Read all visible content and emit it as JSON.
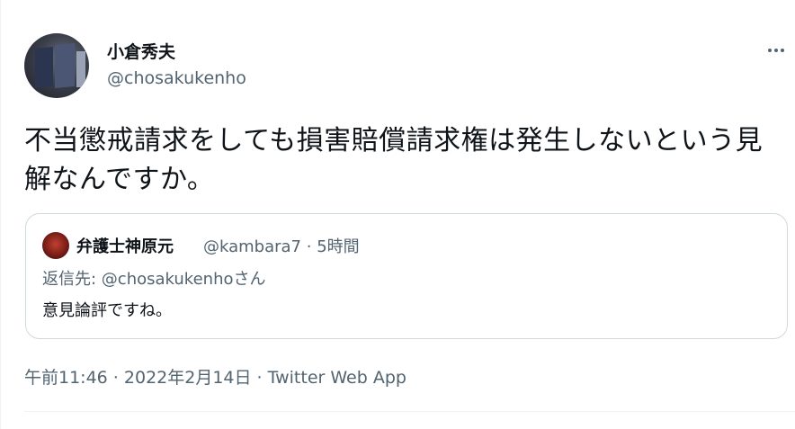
{
  "author": {
    "display_name": "小倉秀夫",
    "handle": "@chosakukenho"
  },
  "tweet": {
    "text": "不当懲戒請求をしても損害賠償請求権は発生しないという見解なんですか。"
  },
  "quoted_tweet": {
    "display_name": "弁護士神原元",
    "handle": "@kambara7",
    "separator": "·",
    "time": "5時間",
    "reply_prefix": "返信先: ",
    "reply_to": "@chosakukenho",
    "reply_suffix": "さん",
    "text": "意見論評ですね。"
  },
  "timestamp": {
    "time": "午前11:46",
    "date": "2022年2月14日",
    "separator": " · ",
    "client": "Twitter Web App"
  },
  "icons": {
    "more": "more-horizontal-icon"
  },
  "colors": {
    "text_primary": "#0f1419",
    "text_secondary": "#536471",
    "border": "#cfd9de"
  }
}
